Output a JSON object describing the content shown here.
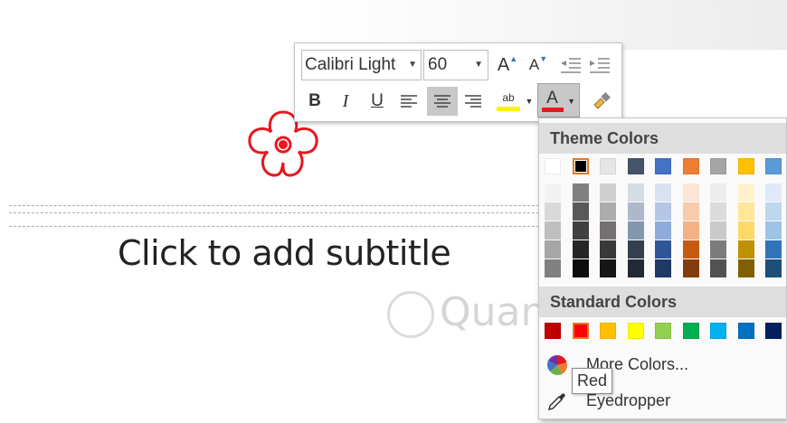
{
  "slide": {
    "subtitle_placeholder": "Click to add subtitle",
    "watermark": "Quantrimang"
  },
  "mini_toolbar": {
    "font_name": "Calibri Light",
    "font_size": "60",
    "buttons": {
      "grow_font": "A",
      "shrink_font": "A",
      "bold": "B",
      "italic": "I",
      "underline": "U",
      "highlight": "ab",
      "font_color": "A"
    },
    "font_color_bar": "#e8171f",
    "highlight_bar": "#fff200"
  },
  "color_dropdown": {
    "theme_header": "Theme Colors",
    "theme_base": [
      "#ffffff",
      "#000000",
      "#e7e6e6",
      "#44546a",
      "#4472c4",
      "#ed7d31",
      "#a5a5a5",
      "#ffc000",
      "#5b9bd5",
      "#70ad47"
    ],
    "theme_shades": [
      [
        "#f2f2f2",
        "#d9d9d9",
        "#bfbfbf",
        "#a6a6a6",
        "#808080"
      ],
      [
        "#808080",
        "#595959",
        "#404040",
        "#262626",
        "#0d0d0d"
      ],
      [
        "#d0cece",
        "#aeabab",
        "#757171",
        "#3a3838",
        "#171616"
      ],
      [
        "#d6dce4",
        "#adb9ca",
        "#8497b0",
        "#333f4f",
        "#222a35"
      ],
      [
        "#d9e2f3",
        "#b4c7e7",
        "#8faadc",
        "#2f5597",
        "#203864"
      ],
      [
        "#fbe5d6",
        "#f8cbad",
        "#f4b183",
        "#c55a11",
        "#843c0c"
      ],
      [
        "#ededed",
        "#dbdbdb",
        "#c9c9c9",
        "#7b7b7b",
        "#525252"
      ],
      [
        "#fff2cc",
        "#ffe699",
        "#ffd966",
        "#bf9000",
        "#7f6000"
      ],
      [
        "#deebf7",
        "#bdd7ee",
        "#9dc3e6",
        "#2e75b6",
        "#1f4e79"
      ],
      [
        "#e2f0d9",
        "#c5e0b4",
        "#a9d18e",
        "#548235",
        "#385723"
      ]
    ],
    "standard_header": "Standard Colors",
    "standard": [
      "#c00000",
      "#ff0000",
      "#ffc000",
      "#ffff00",
      "#92d050",
      "#00b050",
      "#00b0f0",
      "#0070c0",
      "#002060",
      "#7030a0"
    ],
    "more_colors_label": "More Colors...",
    "eyedropper_label": "Eyedropper",
    "tooltip": "Red"
  }
}
